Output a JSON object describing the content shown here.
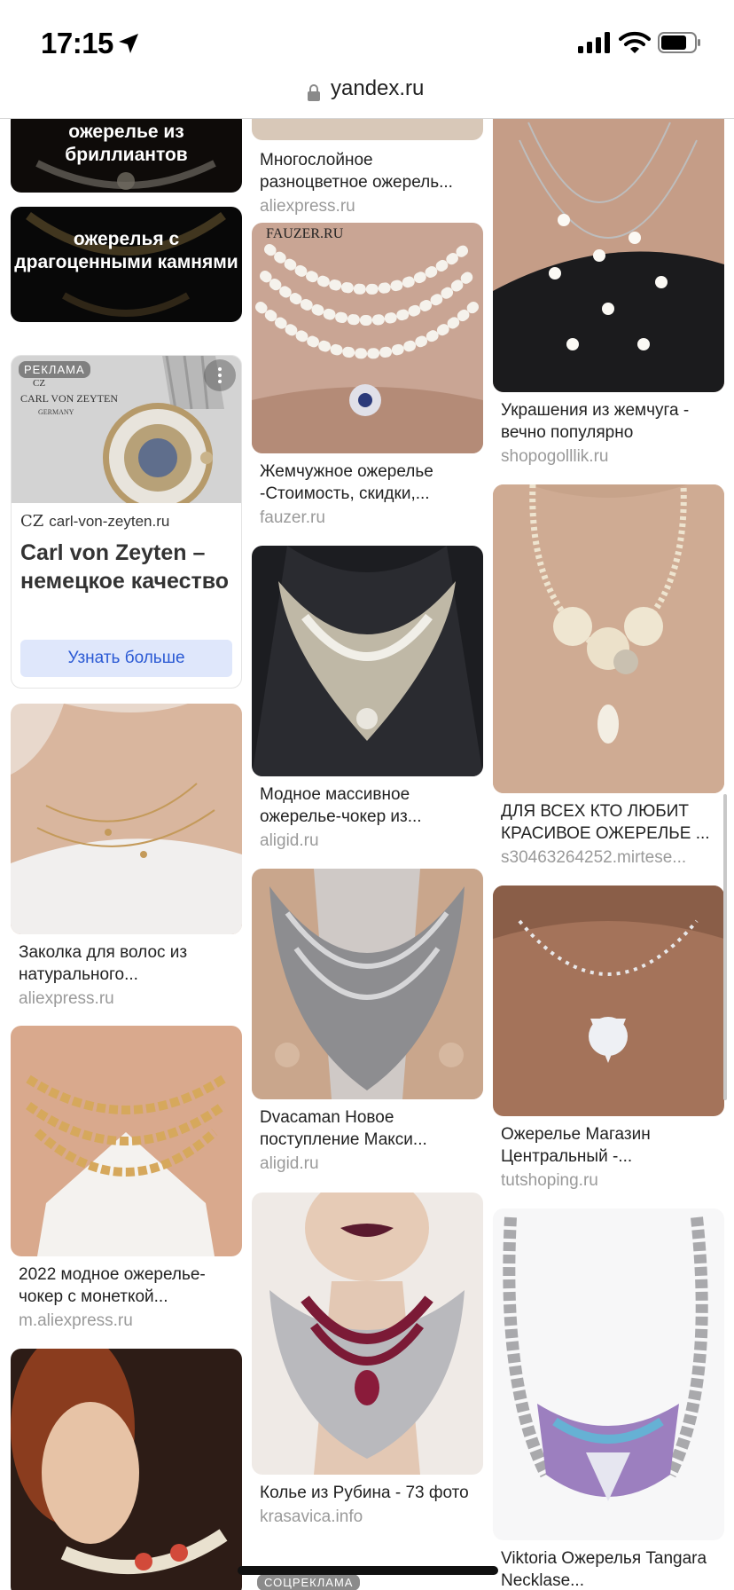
{
  "status": {
    "time": "17:15"
  },
  "browser": {
    "url": "yandex.ru"
  },
  "colors": {
    "accent": "#2b5ad4",
    "ad_button_bg": "#dfe7fb",
    "domain_gray": "#9a9a9a"
  },
  "col1": {
    "tile1": "ожерелье из бриллиантов",
    "tile2": "ожерелья с драгоценными камнями",
    "ad": {
      "badge": "РЕКЛАМА",
      "domain_logo": "CZ",
      "domain": "carl-von-zeyten.ru",
      "title": "Carl von Zeyten – немецкое качество",
      "button": "Узнать больше",
      "image_brand": "CARL VON ZEYTEN",
      "image_country": "GERMANY"
    },
    "cards": [
      {
        "title": "Заколка для волос из натурального...",
        "domain": "aliexpress.ru"
      },
      {
        "title": "2022 модное ожерелье-чокер с монеткой...",
        "domain": "m.aliexpress.ru"
      }
    ]
  },
  "col2": {
    "cards": [
      {
        "title": "Многослойное разноцветное ожерель...",
        "domain": "aliexpress.ru"
      },
      {
        "title": "Жемчужное ожерелье -Стоимость, скидки,...",
        "domain": "fauzer.ru",
        "watermark": "FAUZER.RU"
      },
      {
        "title": "Модное массивное ожерелье-чокер из...",
        "domain": "aligid.ru"
      },
      {
        "title": "Dvacaman Новое поступление Макси...",
        "domain": "aligid.ru"
      },
      {
        "title": "Колье из Рубина - 73 фото",
        "domain": "krasavica.info"
      }
    ],
    "bottom_badge": "СОЦРЕКЛАМА"
  },
  "col3": {
    "cards": [
      {
        "title": "Украшения из жемчуга - вечно популярно",
        "domain": "shopogolllik.ru"
      },
      {
        "title": "ДЛЯ ВСЕХ КТО ЛЮБИТ КРАСИВОЕ ОЖЕРЕЛЬЕ ...",
        "domain": "s30463264252.mirtese..."
      },
      {
        "title": "Ожерелье Магазин Центральный -...",
        "domain": "tutshoping.ru"
      },
      {
        "title": "Viktoria Ожерелья Tangara Necklase...",
        "domain": ""
      }
    ]
  }
}
